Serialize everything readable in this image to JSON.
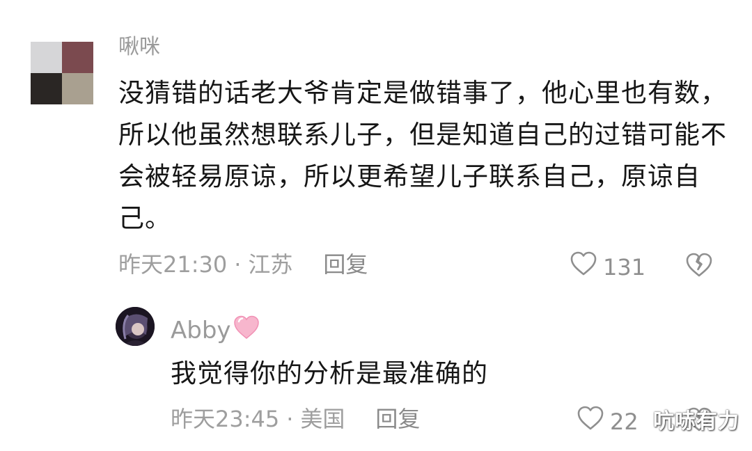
{
  "comment": {
    "avatar_colors": [
      "#d6d6d8",
      "#7b4a4f",
      "#2a2624",
      "#a9a090"
    ],
    "username": "啾咪",
    "text": "没猜错的话老大爷肯定是做错事了，他心里也有数，所以他虽然想联系儿子，但是知道自己的过错可能不会被轻易原谅，所以更希望儿子联系自己，原谅自己。",
    "time": "昨天21:30",
    "separator": "·",
    "location": "江苏",
    "reply_label": "回复",
    "like_count": "131",
    "like_icon": "heart-outline-icon",
    "dislike_icon": "broken-heart-icon"
  },
  "reply": {
    "username": "Abby",
    "badge_icon": "pink-heart-emoji",
    "text": "我觉得你的分析是最准确的",
    "time": "昨天23:45",
    "separator": "·",
    "location": "美国",
    "reply_label": "回复",
    "like_count": "22",
    "like_icon": "heart-outline-icon",
    "dislike_icon": "broken-heart-icon"
  },
  "watermark": "吭哧有力"
}
